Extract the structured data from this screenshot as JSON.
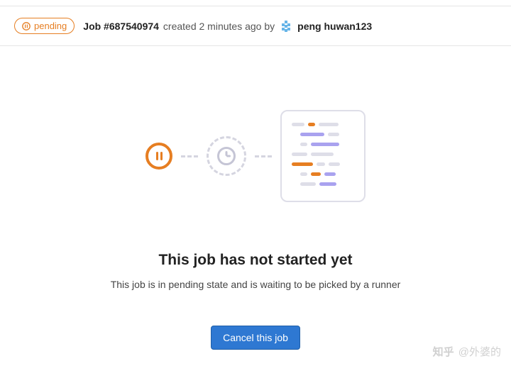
{
  "status": {
    "label": "pending",
    "icon_name": "pause-icon"
  },
  "job": {
    "title": "Job #687540974",
    "created_text": "created 2 minutes ago by",
    "user_name": "peng huwan123"
  },
  "content": {
    "heading": "This job has not started yet",
    "description": "This job is in pending state and is waiting to be picked by a runner"
  },
  "actions": {
    "cancel_label": "Cancel this job"
  },
  "watermark": {
    "prefix": "知乎",
    "text": "@外婆的"
  }
}
